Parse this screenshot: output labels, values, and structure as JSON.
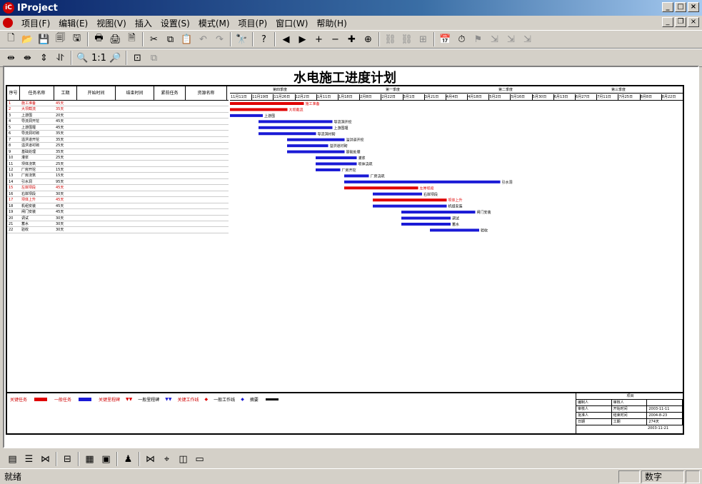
{
  "window": {
    "title": "IProject",
    "logo": "iProject-logo",
    "controls": [
      "_",
      "□",
      "×"
    ]
  },
  "menu": [
    "项目(F)",
    "编辑(E)",
    "视图(V)",
    "插入",
    "设置(S)",
    "模式(M)",
    "项目(P)",
    "窗口(W)",
    "帮助(H)"
  ],
  "toolbar1": [
    {
      "icon": "new-icon",
      "glyph": "🗋"
    },
    {
      "icon": "open-icon",
      "glyph": "📂"
    },
    {
      "icon": "save-icon",
      "glyph": "💾"
    },
    {
      "icon": "save-all-icon",
      "glyph": "🗐"
    },
    {
      "icon": "publish-icon",
      "glyph": "🖫"
    },
    {
      "sep": true
    },
    {
      "icon": "print-icon",
      "glyph": "🖶"
    },
    {
      "icon": "print-preview-icon",
      "glyph": "🖨"
    },
    {
      "icon": "page-setup-icon",
      "glyph": "🗎"
    },
    {
      "sep": true
    },
    {
      "icon": "cut-icon",
      "glyph": "✂"
    },
    {
      "icon": "copy-icon",
      "glyph": "⧉"
    },
    {
      "icon": "paste-icon",
      "glyph": "📋"
    },
    {
      "icon": "undo-icon",
      "glyph": "↶",
      "disabled": true
    },
    {
      "icon": "redo-icon",
      "glyph": "↷",
      "disabled": true
    },
    {
      "sep": true
    },
    {
      "icon": "find-icon",
      "glyph": "🔭"
    },
    {
      "sep": true
    },
    {
      "icon": "help-icon",
      "glyph": "?"
    },
    {
      "sep": true
    },
    {
      "icon": "arrow-left-icon",
      "glyph": "◀"
    },
    {
      "icon": "arrow-right-icon",
      "glyph": "▶"
    },
    {
      "icon": "add-icon",
      "glyph": "+"
    },
    {
      "icon": "remove-icon",
      "glyph": "−"
    },
    {
      "icon": "add-task-icon",
      "glyph": "✚"
    },
    {
      "icon": "add-sub-icon",
      "glyph": "⊕"
    },
    {
      "sep": true
    },
    {
      "icon": "link-icon",
      "glyph": "⛓",
      "disabled": true
    },
    {
      "icon": "unlink-icon",
      "glyph": "⛓",
      "disabled": true
    },
    {
      "icon": "split-icon",
      "glyph": "⊞",
      "disabled": true
    },
    {
      "sep": true
    },
    {
      "icon": "calendar-icon",
      "glyph": "📅"
    },
    {
      "icon": "schedule-icon",
      "glyph": "⏱"
    },
    {
      "icon": "flag-icon",
      "glyph": "⚑",
      "disabled": true
    },
    {
      "icon": "add-resource-icon",
      "glyph": "⇲",
      "disabled": true
    },
    {
      "icon": "resource-link-icon",
      "glyph": "⇲",
      "disabled": true
    },
    {
      "icon": "resource-unlink-icon",
      "glyph": "⇲",
      "disabled": true
    }
  ],
  "toolbar2": [
    {
      "icon": "expand-horizontal-icon",
      "glyph": "⇹"
    },
    {
      "icon": "collapse-horizontal-icon",
      "glyph": "⇼"
    },
    {
      "icon": "expand-vertical-icon",
      "glyph": "⇕"
    },
    {
      "icon": "collapse-vertical-icon",
      "glyph": "⥯"
    },
    {
      "sep": true
    },
    {
      "icon": "zoom-out-icon",
      "glyph": "🔍"
    },
    {
      "icon": "zoom-actual-icon",
      "glyph": "1:1"
    },
    {
      "icon": "zoom-in-icon",
      "glyph": "🔎"
    },
    {
      "sep": true
    },
    {
      "icon": "fit-page-icon",
      "glyph": "⊡"
    },
    {
      "icon": "layers-icon",
      "glyph": "⧉",
      "disabled": true
    }
  ],
  "doc_title": "水电施工进度计划",
  "columns": [
    "序号",
    "任务名称",
    "工期",
    "开始时间",
    "结束时间",
    "紧前任务",
    "资源名称"
  ],
  "timeline_months": [
    "第四季度",
    "第一季度",
    "第二季度",
    "第三季度"
  ],
  "timeline_weeks": [
    "11月11日",
    "11月19日",
    "11月26日",
    "12月2日",
    "1月11日",
    "1月18日",
    "2月8日",
    "2月22日",
    "3月1日",
    "3月21日",
    "4月4日",
    "4月18日",
    "5月2日",
    "5月16日",
    "5月30日",
    "6月13日",
    "6月27日",
    "7月11日",
    "7月25日",
    "8月8日",
    "8月22日"
  ],
  "tasks_visible": [
    {
      "no": "1",
      "name": "施工准备",
      "dur": "45天",
      "crit": true
    },
    {
      "no": "2",
      "name": "大坝截流",
      "dur": "35天",
      "crit": true
    },
    {
      "no": "3",
      "name": "上游围",
      "dur": "20天"
    },
    {
      "no": "4",
      "name": "导流洞开挖",
      "dur": "45天"
    },
    {
      "no": "5",
      "name": "上游围堰",
      "dur": "45天"
    },
    {
      "no": "6",
      "name": "导流洞衬砌",
      "dur": "35天"
    },
    {
      "no": "7",
      "name": "溢洪道开挖",
      "dur": "35天"
    },
    {
      "no": "8",
      "name": "溢洪道衬砌",
      "dur": "25天"
    },
    {
      "no": "9",
      "name": "基础处理",
      "dur": "35天"
    },
    {
      "no": "10",
      "name": "灌浆",
      "dur": "25天"
    },
    {
      "no": "11",
      "name": "坝体浇筑",
      "dur": "25天"
    },
    {
      "no": "12",
      "name": "厂房开挖",
      "dur": "15天"
    },
    {
      "no": "13",
      "name": "厂房浇筑",
      "dur": "15天"
    },
    {
      "no": "14",
      "name": "引水洞",
      "dur": "95天"
    },
    {
      "no": "15",
      "name": "左岸坝段",
      "dur": "45天",
      "crit": true
    },
    {
      "no": "16",
      "name": "右岸坝段",
      "dur": "30天"
    },
    {
      "no": "17",
      "name": "坝体上升",
      "dur": "45天",
      "crit": true
    },
    {
      "no": "18",
      "name": "机组安装",
      "dur": "45天"
    },
    {
      "no": "19",
      "name": "闸门安装",
      "dur": "45天"
    },
    {
      "no": "20",
      "name": "调试",
      "dur": "30天"
    },
    {
      "no": "21",
      "name": "蓄水",
      "dur": "30天"
    },
    {
      "no": "22",
      "name": "验收",
      "dur": "30天"
    }
  ],
  "legend": [
    "关键任务",
    "一般任务",
    "关键里程碑",
    "一般里程碑",
    "一般工作线",
    "关键工作线",
    "摘要"
  ],
  "title_block": {
    "header": "项目",
    "rows": [
      [
        "编制人",
        "审核人"
      ],
      [
        "审核人",
        "开始时间",
        "2003-11-11"
      ],
      [
        "批准人",
        "结束时间",
        "2004-8-23"
      ],
      [
        "日期",
        "工期",
        "274天"
      ]
    ],
    "date": "2003-11-21"
  },
  "bottom_toolbar": [
    {
      "icon": "table-view-icon",
      "glyph": "▤"
    },
    {
      "icon": "gantt-view-icon",
      "glyph": "☰"
    },
    {
      "icon": "network-view-icon",
      "glyph": "⋈"
    },
    {
      "sep": true
    },
    {
      "icon": "resource-view-icon",
      "glyph": "⊟"
    },
    {
      "sep": true
    },
    {
      "icon": "calendar-view-icon",
      "glyph": "▦"
    },
    {
      "icon": "report-view-icon",
      "glyph": "▣"
    },
    {
      "sep": true
    },
    {
      "icon": "person-icon",
      "glyph": "♟"
    },
    {
      "sep": true
    },
    {
      "icon": "compare-icon",
      "glyph": "⋈"
    },
    {
      "icon": "tracking-icon",
      "glyph": "⌖"
    },
    {
      "icon": "split-view-icon",
      "glyph": "◫"
    },
    {
      "icon": "window-icon",
      "glyph": "▭"
    }
  ],
  "status": {
    "left": "就绪",
    "num": "数字"
  },
  "colors": {
    "critical": "#e00000",
    "normal": "#1a1ad6",
    "titlebar": "#0a246a"
  }
}
